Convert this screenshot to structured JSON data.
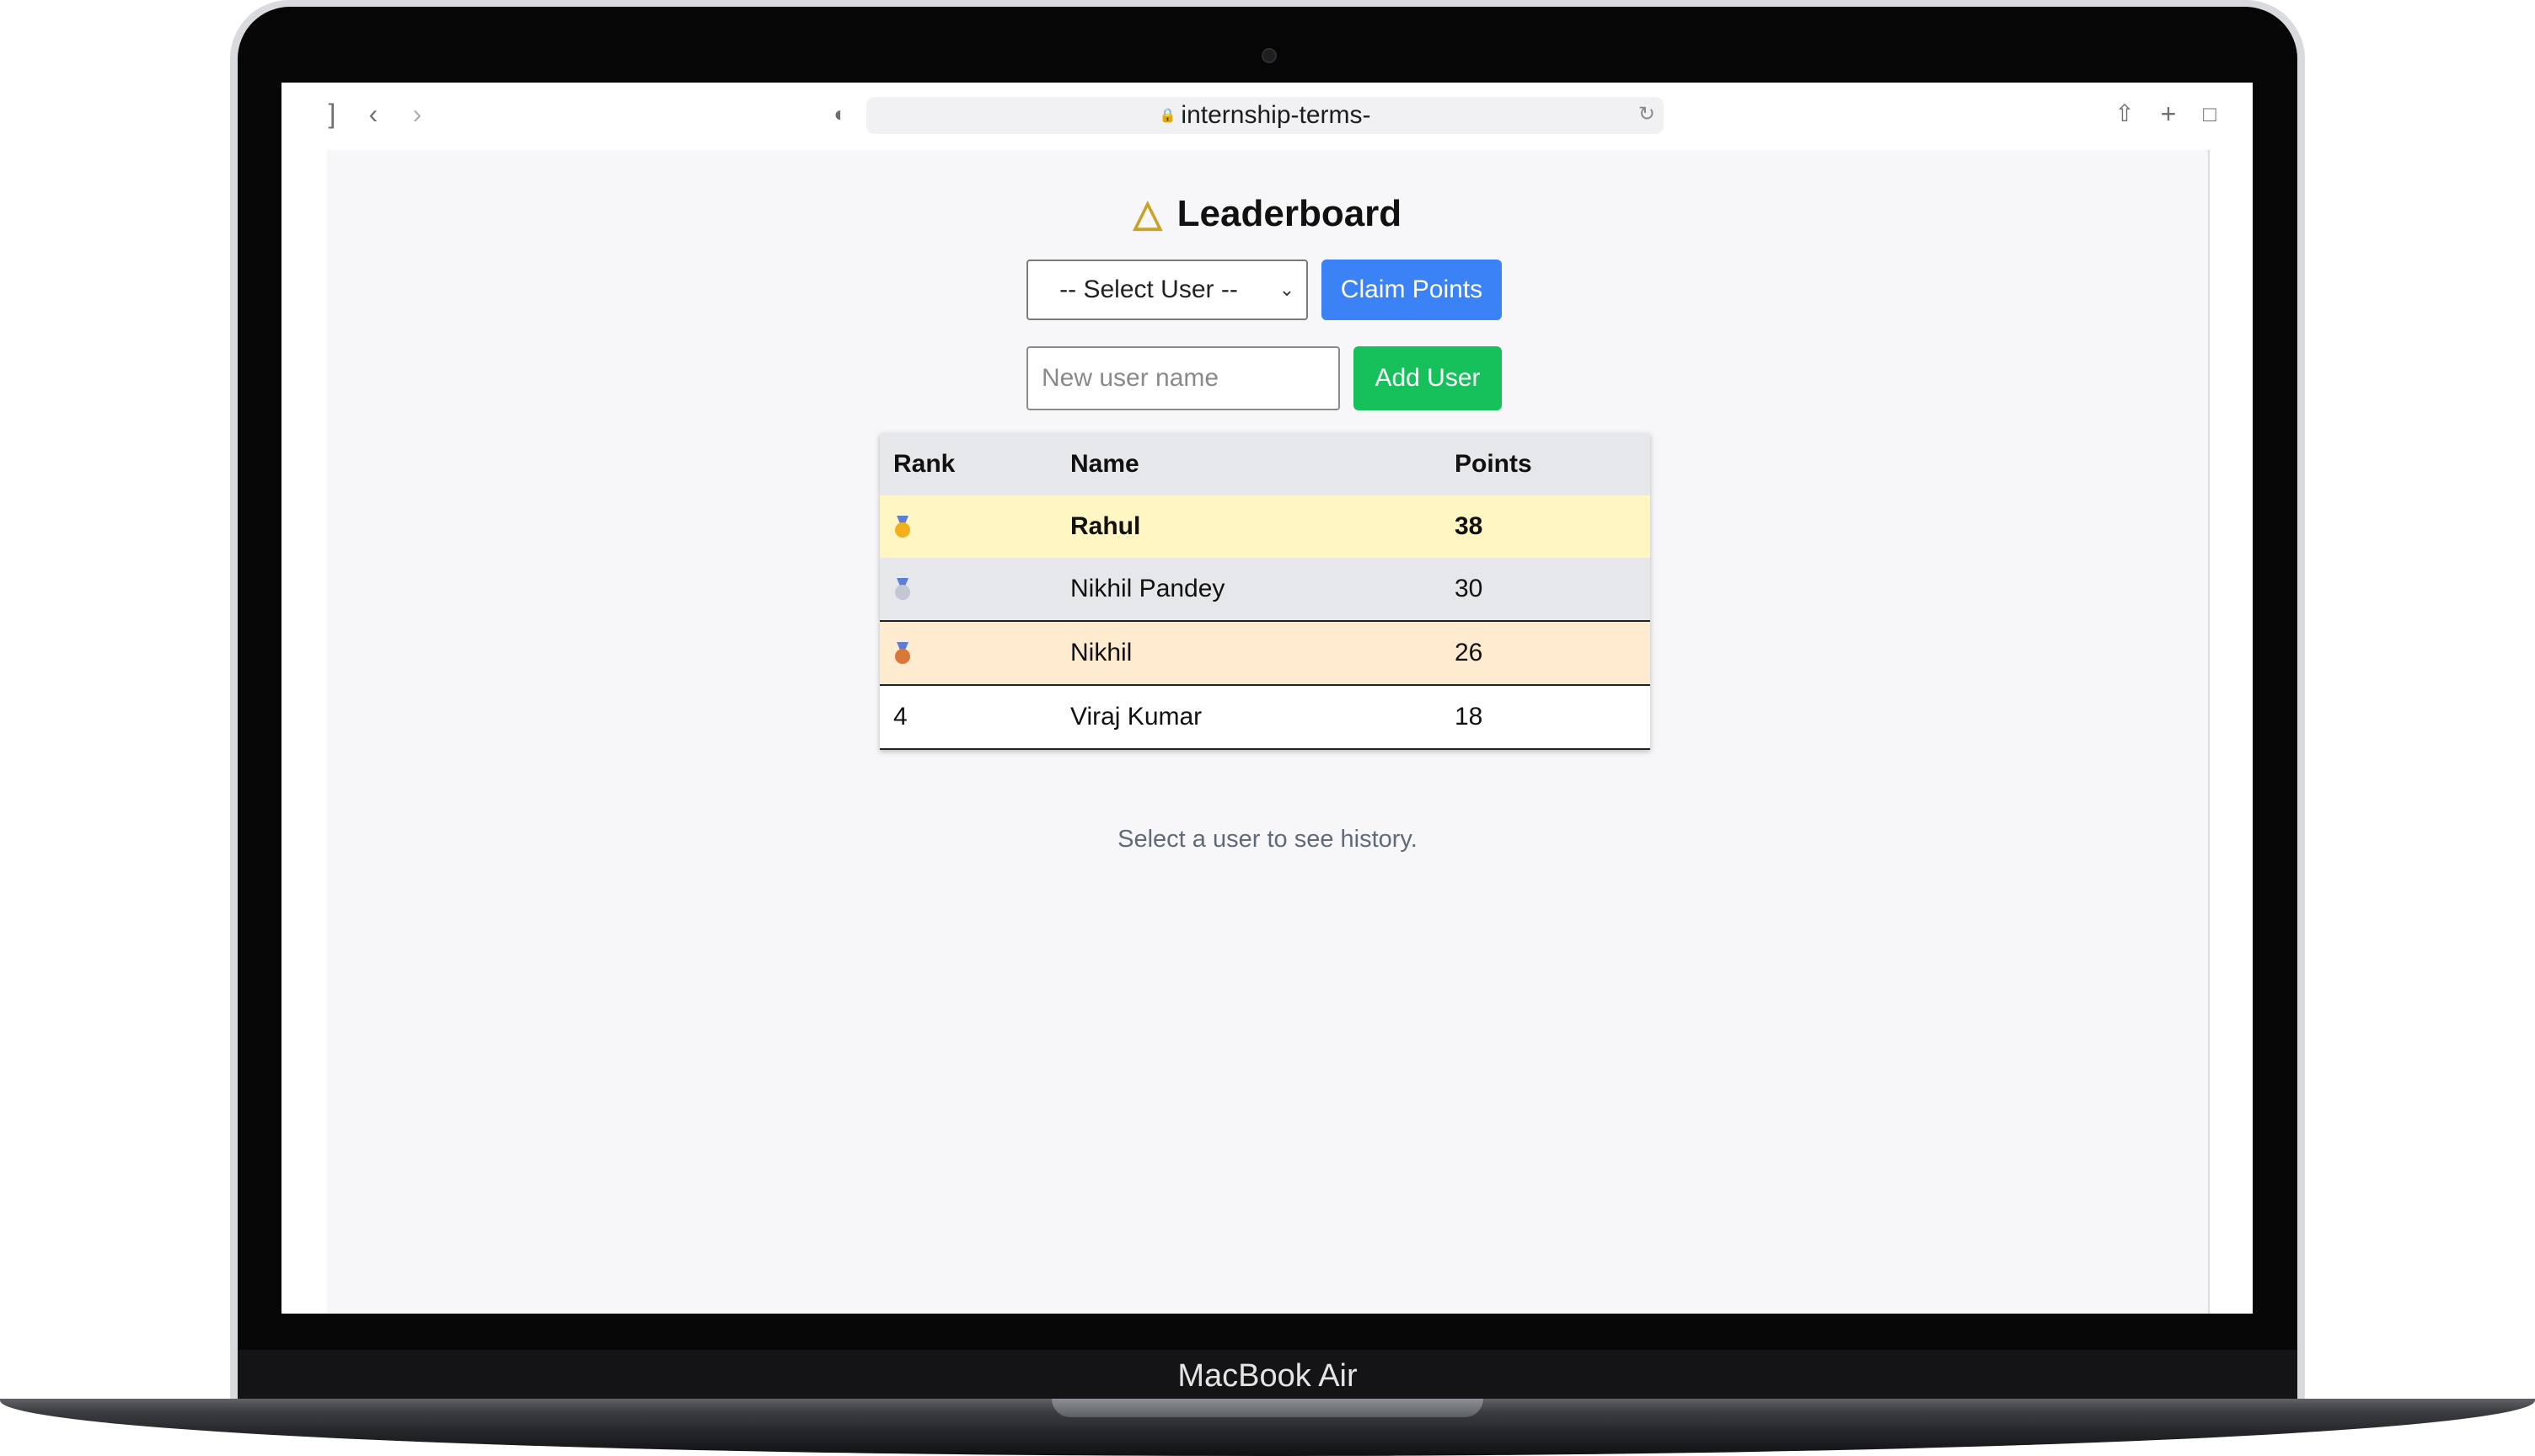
{
  "device": {
    "brand_label": "MacBook Air"
  },
  "browser": {
    "url": "internship-terms-",
    "icons": [
      "sidebar-icon",
      "back-icon",
      "forward-icon",
      "shield-icon",
      "lock-icon",
      "reload-icon",
      "share-icon",
      "new-tab-icon",
      "tabs-icon"
    ]
  },
  "app": {
    "title": "Leaderboard",
    "title_icon": "trophy-icon",
    "select_user": {
      "value": "-- Select User --"
    },
    "claim_button": {
      "label": "Claim Points",
      "color": "#3b82f6"
    },
    "new_user_input": {
      "placeholder": "New user name",
      "value": ""
    },
    "add_button": {
      "label": "Add User",
      "color": "#16c15b"
    },
    "table": {
      "headers": [
        "Rank",
        "Name",
        "Points"
      ],
      "rows": [
        {
          "rank": "",
          "rank_icon": "gold-medal-icon",
          "name": "Rahul",
          "points": "38",
          "row_color": "#fff6c4"
        },
        {
          "rank": "",
          "rank_icon": "silver-medal-icon",
          "name": "Nikhil Pandey",
          "points": "30",
          "row_color": "#e6e7ea"
        },
        {
          "rank": "",
          "rank_icon": "bronze-medal-icon",
          "name": "Nikhil",
          "points": "26",
          "row_color": "#feebd0"
        },
        {
          "rank": "4",
          "rank_icon": "",
          "name": "Viraj Kumar",
          "points": "18",
          "row_color": "#ffffff"
        }
      ]
    },
    "history_hint": "Select a user to see history."
  }
}
